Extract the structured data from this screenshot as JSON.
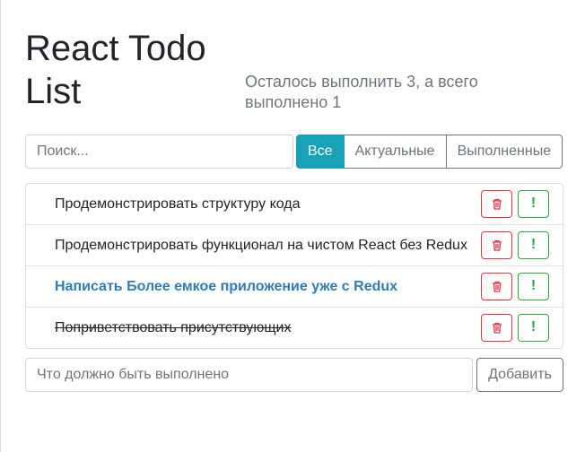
{
  "header": {
    "title": "React Todo List",
    "counter": "Осталось выполнить 3, а всего выполнено 1"
  },
  "search": {
    "placeholder": "Поиск..."
  },
  "filters": [
    {
      "label": "Все",
      "active": true
    },
    {
      "label": "Актуальные",
      "active": false
    },
    {
      "label": "Выполненные",
      "active": false
    }
  ],
  "todos": [
    {
      "label": "Продемонстрировать структуру кода",
      "important": false,
      "done": false
    },
    {
      "label": "Продемонстрировать функционал на чистом React без Redux",
      "important": false,
      "done": false
    },
    {
      "label": "Написать Более емкое приложение уже с Redux",
      "important": true,
      "done": false
    },
    {
      "label": "Поприветствовать присутствующих",
      "important": false,
      "done": true
    }
  ],
  "item_actions": {
    "delete_icon": "trash-icon",
    "important_icon": "exclamation-icon",
    "important_glyph": "!"
  },
  "add_form": {
    "placeholder": "Что должно быть выполнено",
    "button_label": "Добавить"
  },
  "colors": {
    "active_filter": "#17a2b8",
    "important_text": "#2f7db7",
    "delete": "#dc3545",
    "important_button": "#28a745",
    "muted": "#6c757d"
  }
}
